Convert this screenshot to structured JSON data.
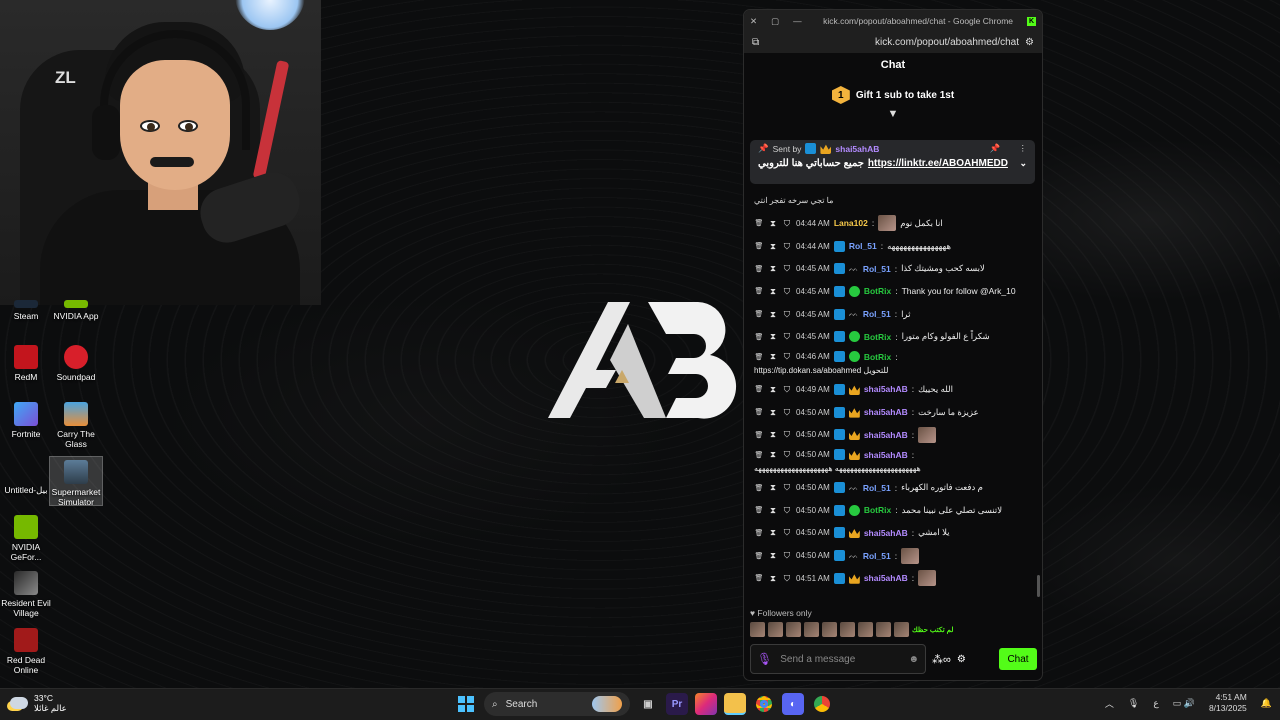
{
  "desktop": {
    "icons": [
      {
        "label": "Steam"
      },
      {
        "label": "NVIDIA App"
      },
      {
        "label": "RedM"
      },
      {
        "label": "Soundpad"
      },
      {
        "label": "Fortnite"
      },
      {
        "label": "Carry The Glass"
      },
      {
        "label": "Untitled-بيل"
      },
      {
        "label": "Supermarket Simulator"
      },
      {
        "label": "NVIDIA GeFor..."
      },
      {
        "label": "Resident Evil Village"
      },
      {
        "label": "Red Dead Online"
      }
    ]
  },
  "webcam": {
    "logo_text": "ZL"
  },
  "logo": {
    "text": "AB"
  },
  "browser": {
    "title": "kick.com/popout/aboahmed/chat - Google Chrome",
    "url": "kick.com/popout/aboahmed/chat"
  },
  "chat": {
    "header": "Chat",
    "gift_number": "1",
    "gift_text": "Gift 1 sub to take 1st",
    "pinned": {
      "sent_by": "Sent by",
      "user": "shai5ahAB",
      "text": "جميع حساباتي هنا للتروبي",
      "link": "https://linktr.ee/ABOAHMEDD"
    },
    "overflow_line": "ما تجي سرخه تفجر انتي",
    "messages": [
      {
        "time": "04:44 AM",
        "user": "Lana102",
        "color": "#f6c84a",
        "text": "انا بكمل نوم",
        "emote": true,
        "badges": []
      },
      {
        "time": "04:44 AM",
        "user": "Rol_51",
        "color": "#7aa2ff",
        "text": "هههههههههههههههه",
        "badges": [
          "vip"
        ]
      },
      {
        "time": "04:45 AM",
        "user": "Rol_51",
        "color": "#7aa2ff",
        "text": "لابسه كحب ومشيتك كذا",
        "badges": [
          "vip",
          "mod"
        ]
      },
      {
        "time": "04:45 AM",
        "user": "BotRix",
        "color": "#27c93f",
        "text": "Thank you for follow @Ark_10",
        "badges": [
          "vip",
          "bot"
        ]
      },
      {
        "time": "04:45 AM",
        "user": "Rol_51",
        "color": "#7aa2ff",
        "text": "ثرا",
        "badges": [
          "vip",
          "mod"
        ]
      },
      {
        "time": "04:45 AM",
        "user": "BotRix",
        "color": "#27c93f",
        "text": "شكراً ع الفولو وكام متورا",
        "badges": [
          "vip",
          "bot"
        ]
      },
      {
        "time": "04:46 AM",
        "user": "BotRix",
        "color": "#27c93f",
        "text": "https://tip.dokan.sa/aboahmed للتحويل",
        "badges": [
          "vip",
          "bot"
        ],
        "wrap": true
      },
      {
        "time": "04:49 AM",
        "user": "shai5ahAB",
        "color": "#b38bff",
        "text": "الله يحييك",
        "badges": [
          "vip",
          "crown"
        ]
      },
      {
        "time": "04:50 AM",
        "user": "shai5ahAB",
        "color": "#b38bff",
        "text": "عزيزة ما سارخت",
        "badges": [
          "vip",
          "crown"
        ]
      },
      {
        "time": "04:50 AM",
        "user": "shai5ahAB",
        "color": "#b38bff",
        "text": "",
        "emote": true,
        "badges": [
          "vip",
          "crown"
        ]
      },
      {
        "time": "04:50 AM",
        "user": "shai5ahAB",
        "color": "#b38bff",
        "text": "ههههههههههههههههههههههه ههههههههههههههههههههه",
        "badges": [
          "vip",
          "crown"
        ],
        "wrap": true
      },
      {
        "time": "04:50 AM",
        "user": "Rol_51",
        "color": "#7aa2ff",
        "text": "م دفعت فاتوره الكهرباء",
        "badges": [
          "vip",
          "mod"
        ]
      },
      {
        "time": "04:50 AM",
        "user": "BotRix",
        "color": "#27c93f",
        "text": "لاتنسى تصلي على نبينا محمد",
        "badges": [
          "vip",
          "bot"
        ]
      },
      {
        "time": "04:50 AM",
        "user": "shai5ahAB",
        "color": "#b38bff",
        "text": "يلا امشي",
        "badges": [
          "vip",
          "crown"
        ]
      },
      {
        "time": "04:50 AM",
        "user": "Rol_51",
        "color": "#7aa2ff",
        "text": "",
        "emote": true,
        "badges": [
          "vip",
          "mod"
        ]
      },
      {
        "time": "04:51 AM",
        "user": "shai5ahAB",
        "color": "#b38bff",
        "text": "",
        "emote": true,
        "badges": [
          "vip",
          "crown"
        ]
      }
    ],
    "followers_only": "Followers only",
    "emote_text": "لم تكتب حظك",
    "input_placeholder": "Send a message",
    "chat_button": "Chat"
  },
  "taskbar": {
    "temperature": "33°C",
    "weather_text": "عالم غائلا",
    "search_label": "Search",
    "language": "ع",
    "time": "4:51 AM",
    "date": "8/13/2025"
  }
}
